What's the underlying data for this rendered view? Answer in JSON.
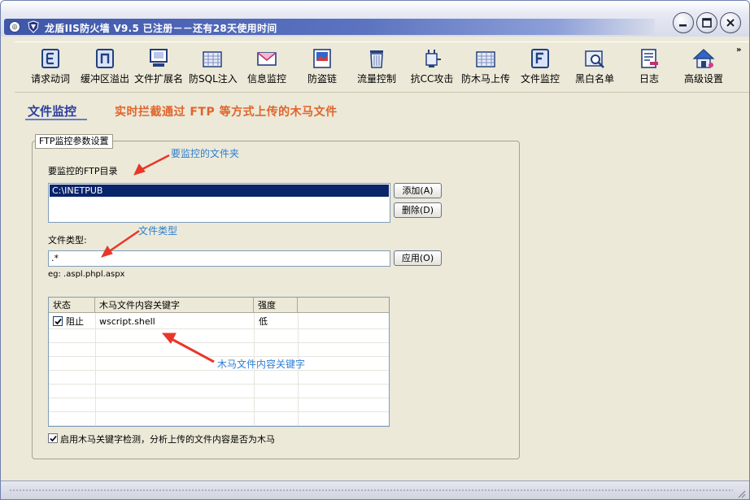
{
  "window": {
    "title": "龙盾IIS防火墙 V9.5 已注册－－还有28天使用时间",
    "controls": [
      "minimize-icon",
      "maximize-icon",
      "close-icon"
    ]
  },
  "toolbar": {
    "items": [
      {
        "label": "请求动词",
        "icon": "e-box-icon"
      },
      {
        "label": "缓冲区溢出",
        "icon": "n-box-icon"
      },
      {
        "label": "文件扩展名",
        "icon": "monitor-icon"
      },
      {
        "label": "防SQL注入",
        "icon": "grid-icon"
      },
      {
        "label": "信息监控",
        "icon": "envelope-icon"
      },
      {
        "label": "防盗链",
        "icon": "picture-icon"
      },
      {
        "label": "流量控制",
        "icon": "trash-icon"
      },
      {
        "label": "抗CC攻击",
        "icon": "plug-icon"
      },
      {
        "label": "防木马上传",
        "icon": "grid-icon"
      },
      {
        "label": "文件监控",
        "icon": "f-box-icon"
      },
      {
        "label": "黑白名单",
        "icon": "magnifier-icon"
      },
      {
        "label": "日志",
        "icon": "document-icon"
      },
      {
        "label": "高级设置",
        "icon": "house-icon"
      }
    ],
    "more": "»"
  },
  "page": {
    "title": "文件监控",
    "slogan": "实时拦截通过 FTP 等方式上传的木马文件"
  },
  "ftp_group": {
    "legend": "FTP监控参数设置",
    "dir_label": "要监控的FTP目录",
    "dirs": [
      "C:\\INETPUB"
    ],
    "add_button": "添加(A)",
    "delete_button": "删除(D)",
    "filetype_label": "文件类型:",
    "filetype_value": ".*",
    "apply_button": "应用(O)",
    "example": "eg: .aspl.phpl.aspx",
    "table": {
      "columns": [
        "状态",
        "木马文件内容关键字",
        "强度"
      ],
      "rows": [
        {
          "checked": true,
          "status": "阻止",
          "keyword": "wscript.shell",
          "strength": "低"
        }
      ]
    },
    "enable_checkbox": {
      "checked": true,
      "label": "启用木马关键字检测，分析上传的文件内容是否为木马"
    }
  },
  "annotations": {
    "folder": "要监控的文件夹",
    "filetype": "文件类型",
    "keyword": "木马文件内容关键字",
    "color": "#2d7fd1",
    "arrow_color": "#e8372a"
  },
  "colors": {
    "title_blue": "#2a3ea0",
    "slogan_orange": "#e0642c",
    "selection": "#0a246a"
  }
}
